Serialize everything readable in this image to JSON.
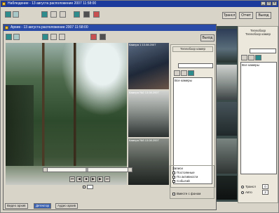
{
  "outer": {
    "title": "Наблюдение - 13 августа расположение 2007 11:58:00",
    "buttons": {
      "realtime": "Трансл",
      "archive": "Отчет",
      "exit": "Выход"
    }
  },
  "inner": {
    "title": "Архив - 13 августа расположение 2007 11:58:00",
    "exit": "Выход",
    "cameras": [
      {
        "label": "Камера 1    13.08.2007"
      },
      {
        "label": "Камера №2   13.08.2007"
      },
      {
        "label": "Камера №3   13.08.2007"
      }
    ],
    "cam_panel": {
      "title": "Телеобзор камер",
      "list_label": "Все камеры"
    },
    "records": {
      "title": "Записи",
      "options": [
        "Постоянные",
        "По активности",
        "Событий"
      ],
      "background": "Вместе с фоном"
    },
    "tabs": [
      "Видео архив",
      "Детектор",
      "Аудио архив"
    ]
  },
  "right_panel": {
    "title": "Телеобзор",
    "subtitle": "Телеобзор камер",
    "list_label": "Все камеры",
    "options": [
      {
        "label": "Трансл",
        "value": "0"
      },
      {
        "label": "Авто",
        "value": "2"
      }
    ]
  },
  "colors": {
    "titlebar": "#1c3a9c",
    "frame": "#d8d4c8",
    "video_bg": "#2a3a2c"
  }
}
